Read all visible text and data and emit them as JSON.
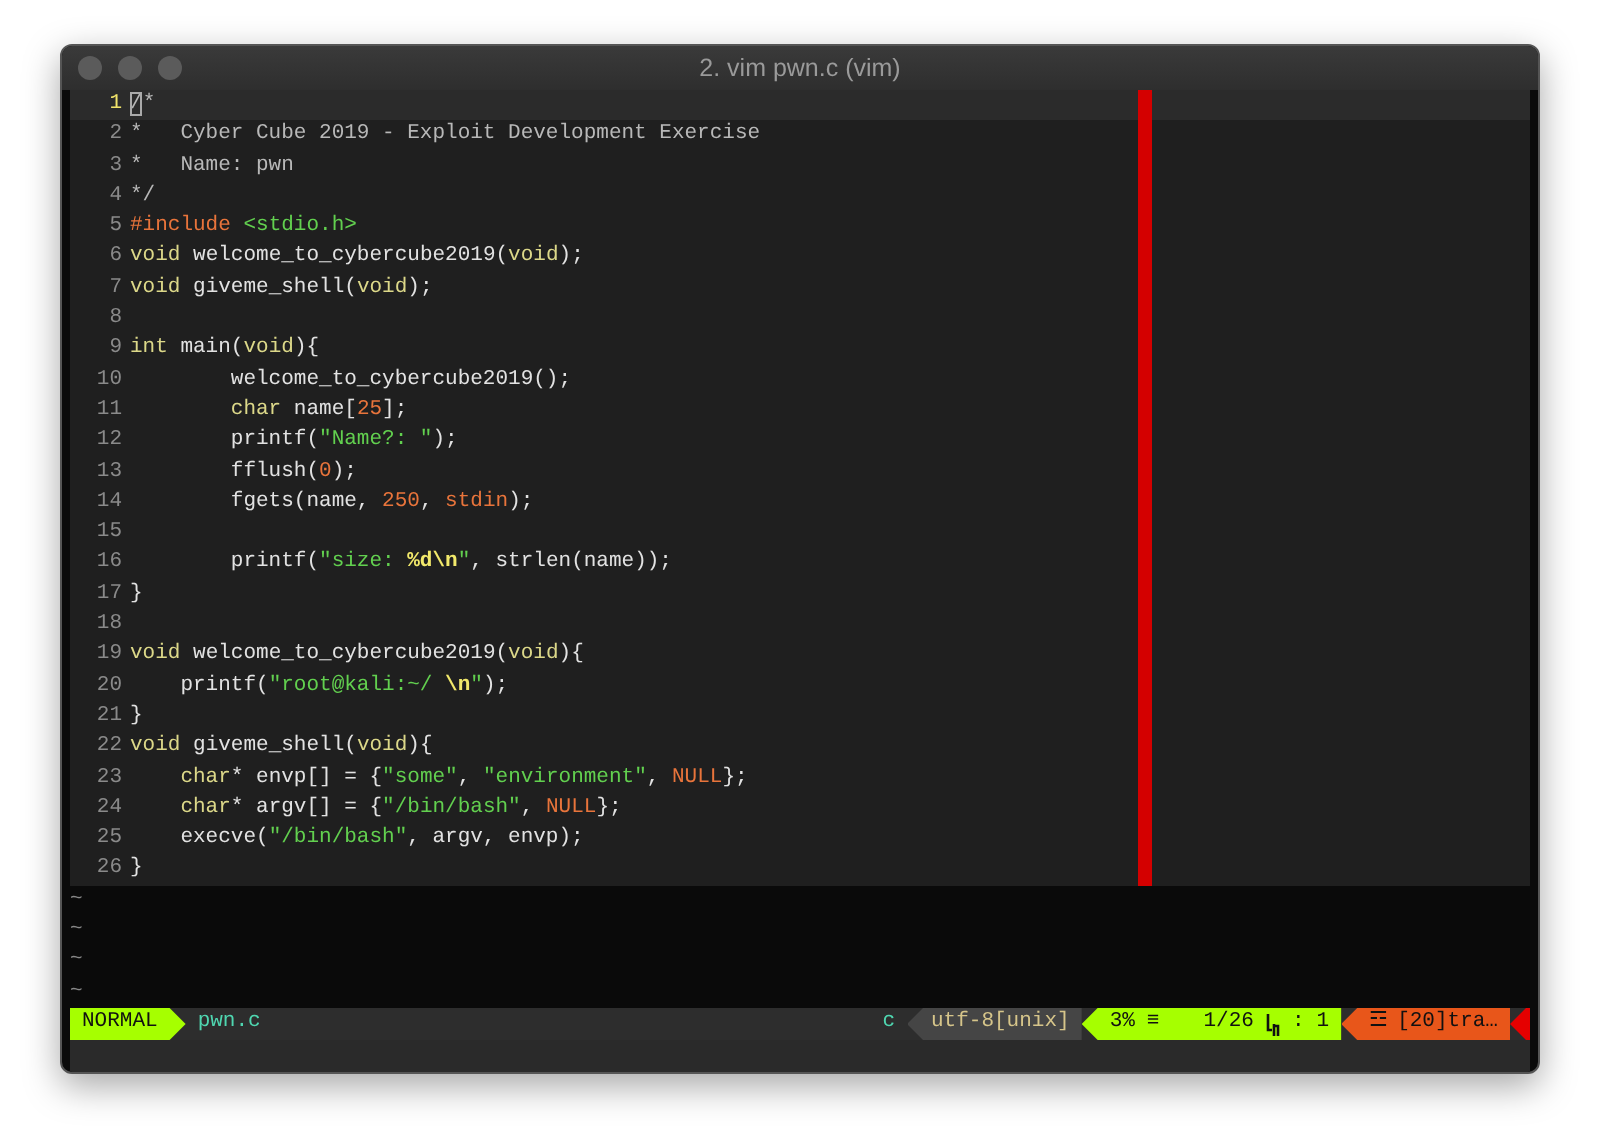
{
  "window": {
    "title": "2. vim pwn.c (vim)"
  },
  "lines": [
    {
      "number": "1",
      "current": true,
      "tokens": [
        {
          "text": "/*",
          "kind": "comment"
        }
      ]
    },
    {
      "number": "2",
      "current": false,
      "tokens": [
        {
          "text": "*   Cyber Cube 2019 - Exploit Development Exercise",
          "kind": "comment"
        }
      ]
    },
    {
      "number": "3",
      "current": false,
      "tokens": [
        {
          "text": "*   Name: pwn",
          "kind": "comment"
        }
      ]
    },
    {
      "number": "4",
      "current": false,
      "tokens": [
        {
          "text": "*/",
          "kind": "comment"
        }
      ]
    },
    {
      "number": "5",
      "current": false,
      "tokens": [
        {
          "text": "#include ",
          "kind": "preproc"
        },
        {
          "text": "<stdio.h>",
          "kind": "string"
        }
      ]
    },
    {
      "number": "6",
      "current": false,
      "tokens": [
        {
          "text": "void",
          "kind": "type"
        },
        {
          "text": " welcome_to_cybercube2019(",
          "kind": "plain"
        },
        {
          "text": "void",
          "kind": "type"
        },
        {
          "text": ");",
          "kind": "plain"
        }
      ]
    },
    {
      "number": "7",
      "current": false,
      "tokens": [
        {
          "text": "void",
          "kind": "type"
        },
        {
          "text": " giveme_shell(",
          "kind": "plain"
        },
        {
          "text": "void",
          "kind": "type"
        },
        {
          "text": ");",
          "kind": "plain"
        }
      ]
    },
    {
      "number": "8",
      "current": false
    },
    {
      "number": "9",
      "current": false,
      "tokens": [
        {
          "text": "int",
          "kind": "type"
        },
        {
          "text": " main(",
          "kind": "plain"
        },
        {
          "text": "void",
          "kind": "type"
        },
        {
          "text": "){",
          "kind": "plain"
        }
      ]
    },
    {
      "number": "10",
      "current": false,
      "tokens": [
        {
          "text": "        welcome_to_cybercube2019();",
          "kind": "plain"
        }
      ]
    },
    {
      "number": "11",
      "current": false,
      "tokens": [
        {
          "text": "        char",
          "kind": "type"
        },
        {
          "text": " name[",
          "kind": "plain"
        },
        {
          "text": "25",
          "kind": "number"
        },
        {
          "text": "];",
          "kind": "plain"
        }
      ]
    },
    {
      "number": "12",
      "current": false,
      "tokens": [
        {
          "text": "        printf(",
          "kind": "plain"
        },
        {
          "text": "\"Name?: \"",
          "kind": "string"
        },
        {
          "text": ");",
          "kind": "plain"
        }
      ]
    },
    {
      "number": "13",
      "current": false,
      "tokens": [
        {
          "text": "        fflush(",
          "kind": "plain"
        },
        {
          "text": "0",
          "kind": "number"
        },
        {
          "text": ");",
          "kind": "plain"
        }
      ]
    },
    {
      "number": "14",
      "current": false,
      "tokens": [
        {
          "text": "        fgets(name, ",
          "kind": "plain"
        },
        {
          "text": "250",
          "kind": "number"
        },
        {
          "text": ", ",
          "kind": "plain"
        },
        {
          "text": "stdin",
          "kind": "constant"
        },
        {
          "text": ");",
          "kind": "plain"
        }
      ]
    },
    {
      "number": "15",
      "current": false
    },
    {
      "number": "16",
      "current": false,
      "tokens": [
        {
          "text": "        printf(",
          "kind": "plain"
        },
        {
          "text": "\"size: ",
          "kind": "string"
        },
        {
          "text": "%d\\n",
          "kind": "escape"
        },
        {
          "text": "\"",
          "kind": "string"
        },
        {
          "text": ", strlen(name));",
          "kind": "plain"
        }
      ]
    },
    {
      "number": "17",
      "current": false,
      "tokens": [
        {
          "text": "}",
          "kind": "plain"
        }
      ]
    },
    {
      "number": "18",
      "current": false
    },
    {
      "number": "19",
      "current": false,
      "tokens": [
        {
          "text": "void",
          "kind": "type"
        },
        {
          "text": " welcome_to_cybercube2019(",
          "kind": "plain"
        },
        {
          "text": "void",
          "kind": "type"
        },
        {
          "text": "){",
          "kind": "plain"
        }
      ]
    },
    {
      "number": "20",
      "current": false,
      "tokens": [
        {
          "text": "    printf(",
          "kind": "plain"
        },
        {
          "text": "\"root@kali:~/ ",
          "kind": "string"
        },
        {
          "text": "\\n",
          "kind": "escape"
        },
        {
          "text": "\"",
          "kind": "string"
        },
        {
          "text": ");",
          "kind": "plain"
        }
      ]
    },
    {
      "number": "21",
      "current": false,
      "tokens": [
        {
          "text": "}",
          "kind": "plain"
        }
      ]
    },
    {
      "number": "22",
      "current": false,
      "tokens": [
        {
          "text": "void",
          "kind": "type"
        },
        {
          "text": " giveme_shell(",
          "kind": "plain"
        },
        {
          "text": "void",
          "kind": "type"
        },
        {
          "text": "){",
          "kind": "plain"
        }
      ]
    },
    {
      "number": "23",
      "current": false,
      "tokens": [
        {
          "text": "    char",
          "kind": "type"
        },
        {
          "text": "* envp[] = {",
          "kind": "plain"
        },
        {
          "text": "\"some\"",
          "kind": "string"
        },
        {
          "text": ", ",
          "kind": "plain"
        },
        {
          "text": "\"environment\"",
          "kind": "string"
        },
        {
          "text": ", ",
          "kind": "plain"
        },
        {
          "text": "NULL",
          "kind": "constant"
        },
        {
          "text": "};",
          "kind": "plain"
        }
      ]
    },
    {
      "number": "24",
      "current": false,
      "tokens": [
        {
          "text": "    char",
          "kind": "type"
        },
        {
          "text": "* argv[] = {",
          "kind": "plain"
        },
        {
          "text": "\"/bin/bash\"",
          "kind": "string"
        },
        {
          "text": ", ",
          "kind": "plain"
        },
        {
          "text": "NULL",
          "kind": "constant"
        },
        {
          "text": "};",
          "kind": "plain"
        }
      ]
    },
    {
      "number": "25",
      "current": false,
      "tokens": [
        {
          "text": "    execve(",
          "kind": "plain"
        },
        {
          "text": "\"/bin/bash\"",
          "kind": "string"
        },
        {
          "text": ", argv, envp);",
          "kind": "plain"
        }
      ]
    },
    {
      "number": "26",
      "current": false,
      "tokens": [
        {
          "text": "}",
          "kind": "plain"
        }
      ]
    }
  ],
  "empty_lines": [
    "~",
    "~",
    "~",
    "~"
  ],
  "status_line": {
    "mode": "NORMAL",
    "filename": "pwn.c",
    "filetype": "c",
    "encoding": "utf-8[unix]",
    "percent": "3%",
    "percent_icon": "≡",
    "position": "1/26",
    "separator": ":",
    "column": "1",
    "warning_icon": "☲",
    "warning": "[20]tra…"
  }
}
